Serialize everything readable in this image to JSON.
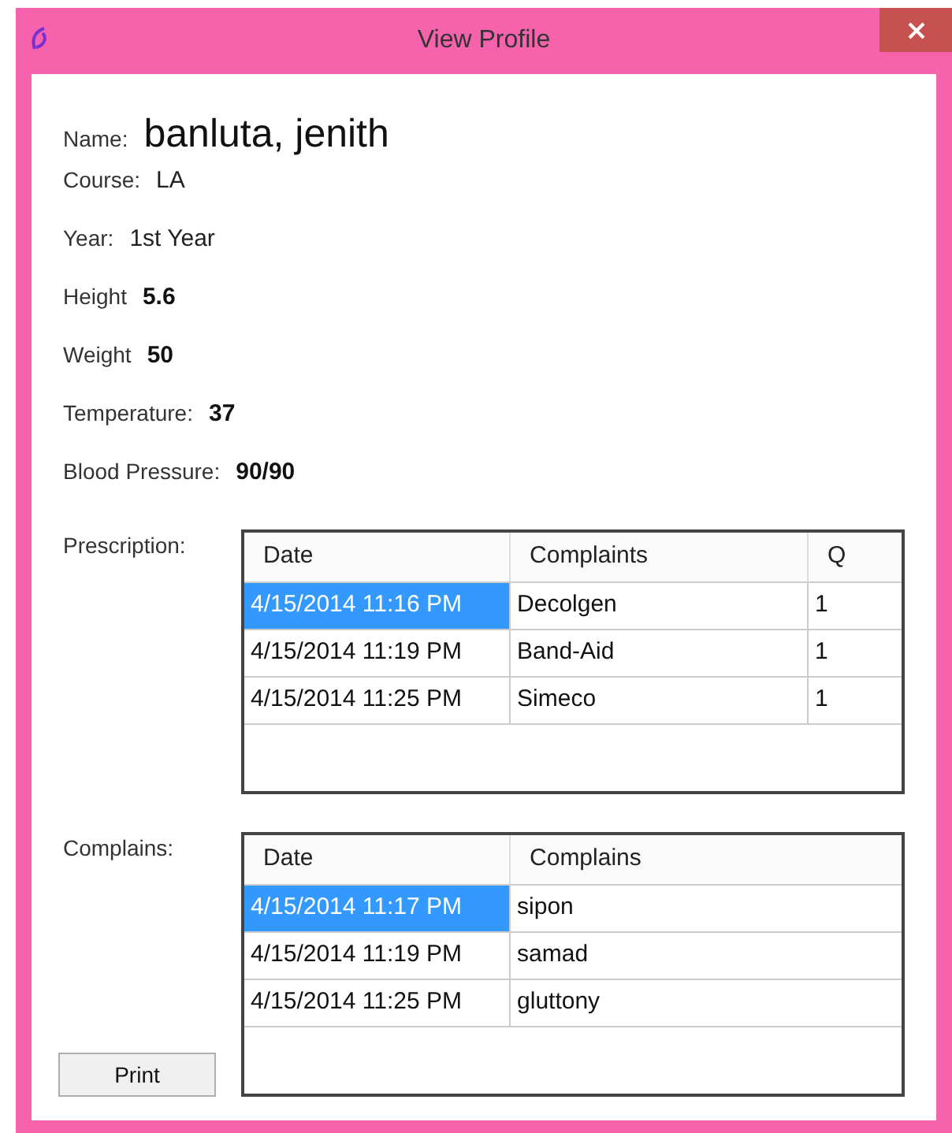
{
  "window": {
    "title": "View Profile"
  },
  "fields": [
    {
      "label": "Name:",
      "value": "banluta, jenith",
      "kind": "title"
    },
    {
      "label": "Course:",
      "value": "LA",
      "kind": "plain"
    },
    {
      "label": "Year:",
      "value": "1st Year",
      "kind": "plain"
    },
    {
      "label": "Height",
      "value": "5.6",
      "kind": "bold"
    },
    {
      "label": "Weight",
      "value": "50",
      "kind": "bold"
    },
    {
      "label": "Temperature:",
      "value": "37",
      "kind": "bold"
    },
    {
      "label": "Blood Pressure:",
      "value": "90/90",
      "kind": "bold"
    }
  ],
  "prescription": {
    "label": "Prescription:",
    "columns": [
      "Date",
      "Complaints",
      "Q"
    ],
    "rows": [
      {
        "cells": [
          "4/15/2014 11:16 PM",
          "Decolgen",
          "1"
        ],
        "selected": true
      },
      {
        "cells": [
          "4/15/2014 11:19 PM",
          "Band-Aid",
          "1"
        ],
        "selected": false
      },
      {
        "cells": [
          "4/15/2014 11:25 PM",
          "Simeco",
          "1"
        ],
        "selected": false
      }
    ]
  },
  "complains": {
    "label": "Complains:",
    "columns": [
      "Date",
      "Complains"
    ],
    "rows": [
      {
        "cells": [
          "4/15/2014 11:17 PM",
          "sipon"
        ],
        "selected": true
      },
      {
        "cells": [
          "4/15/2014 11:19 PM",
          "samad"
        ],
        "selected": false
      },
      {
        "cells": [
          "4/15/2014 11:25 PM",
          "gluttony"
        ],
        "selected": false
      }
    ]
  },
  "print_button": "Print"
}
